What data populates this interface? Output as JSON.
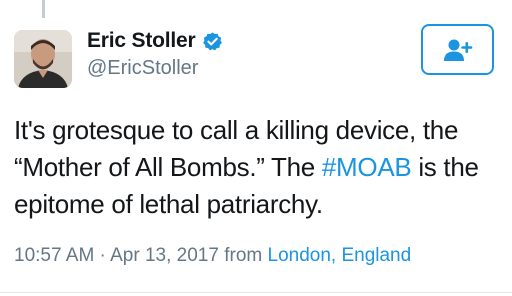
{
  "author": {
    "display_name": "Eric Stoller",
    "handle": "@EricStoller",
    "verified": true,
    "avatar_icon": "user-photo-icon"
  },
  "follow_button": {
    "icon": "add-user-icon",
    "color": "#1b95e0"
  },
  "tweet": {
    "line1": "It's grotesque to call a killing device, the",
    "line2_before": "“Mother of All Bombs.” The ",
    "hashtag": "#MOAB",
    "line2_after": " is the",
    "line3": "epitome of lethal patriarchy."
  },
  "meta": {
    "time": "10:57 AM",
    "separator": " · ",
    "date": "Apr 13, 2017",
    "from_label": " from ",
    "location": "London, England"
  },
  "colors": {
    "link": "#1b95e0",
    "secondary_text": "#657786",
    "primary_text": "#14171a"
  }
}
